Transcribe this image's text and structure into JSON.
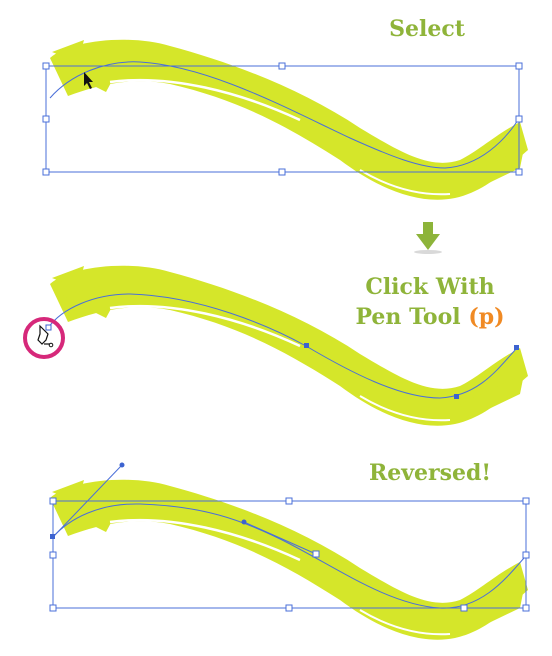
{
  "steps": [
    {
      "label": "Select"
    },
    {
      "label_line1": "Click With",
      "label_line2_prefix": "Pen Tool",
      "shortcut": "(p)"
    },
    {
      "label": "Reversed!"
    }
  ],
  "colors": {
    "stroke_fill": "#d5e62a",
    "path_line": "#4a6fd8",
    "handle": "#3d63d0",
    "label_text": "#8fb43a",
    "shortcut_text": "#f08a24",
    "highlight_circle": "#d6287a",
    "arrow": "#8db43a"
  },
  "icons": [
    "selection-cursor-icon",
    "pen-tool-cursor-icon",
    "down-arrow-icon"
  ]
}
